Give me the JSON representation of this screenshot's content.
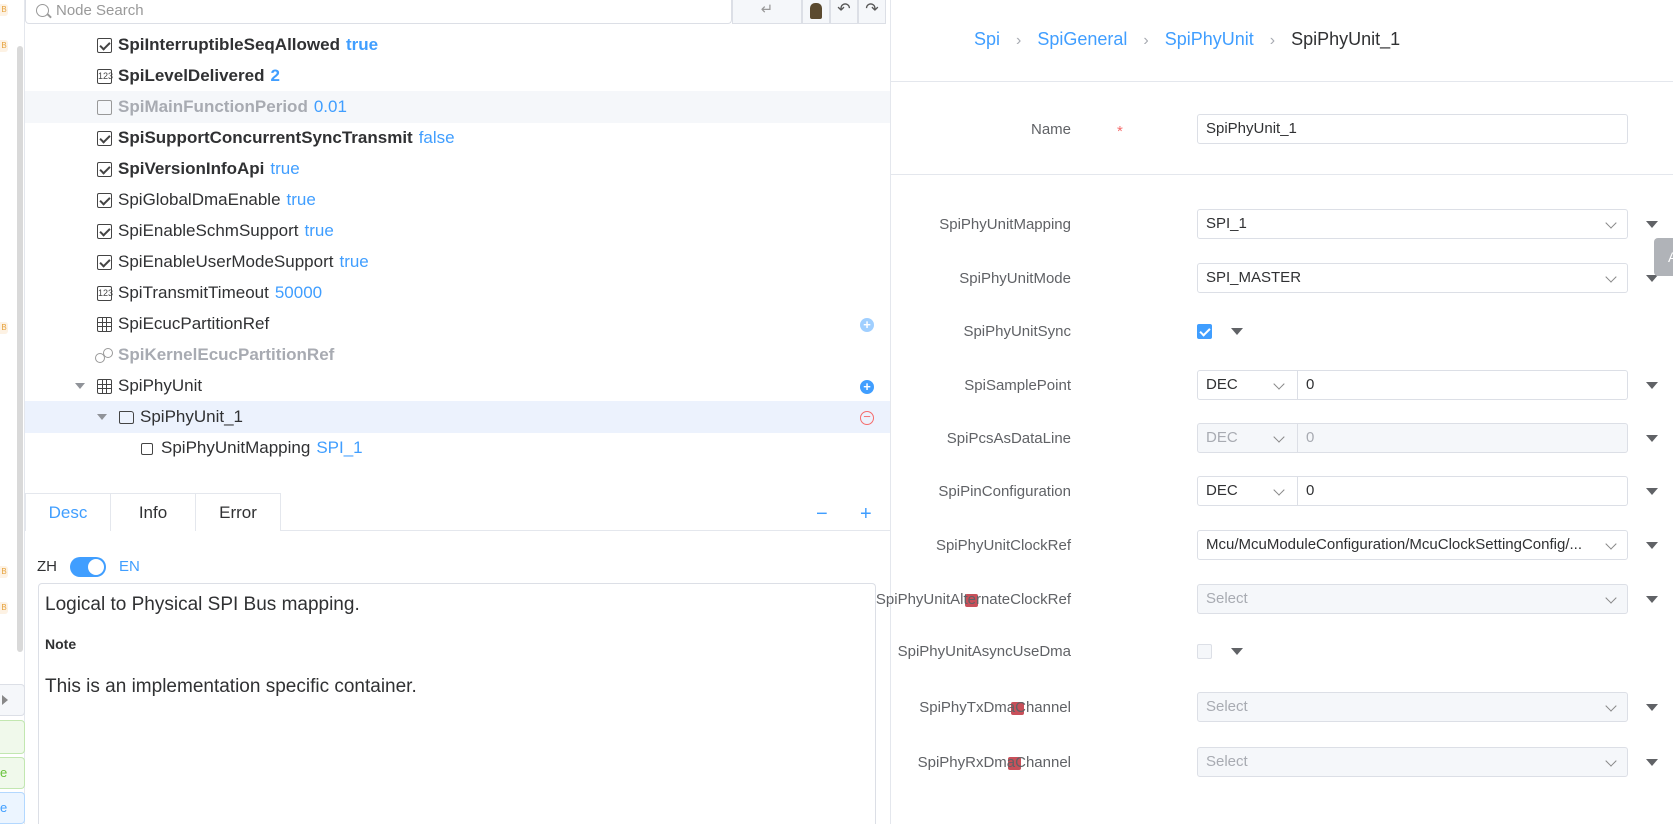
{
  "search": {
    "placeholder": "Node Search",
    "enter_glyph": "↵",
    "undo_glyph": "↶",
    "redo_glyph": "↷"
  },
  "strip": {
    "badge": "B",
    "btn_text_1": "e",
    "btn_text_2": "e"
  },
  "tree": {
    "rows": [
      {
        "label": "SpiInterruptibleSeqAllowed",
        "value": "true"
      },
      {
        "label": "SpiLevelDelivered",
        "value": "2"
      },
      {
        "label": "SpiMainFunctionPeriod",
        "value": "0.01"
      },
      {
        "label": "SpiSupportConcurrentSyncTransmit",
        "value": "false"
      },
      {
        "label": "SpiVersionInfoApi",
        "value": "true"
      },
      {
        "label": "SpiGlobalDmaEnable",
        "value": "true"
      },
      {
        "label": "SpiEnableSchmSupport",
        "value": "true"
      },
      {
        "label": "SpiEnableUserModeSupport",
        "value": "true"
      },
      {
        "label": "SpiTransmitTimeout",
        "value": "50000"
      },
      {
        "label": "SpiEcucPartitionRef",
        "value": ""
      },
      {
        "label": "SpiKernelEcucPartitionRef",
        "value": ""
      },
      {
        "label": "SpiPhyUnit",
        "value": ""
      },
      {
        "label": "SpiPhyUnit_1",
        "value": ""
      },
      {
        "label": "SpiPhyUnitMapping",
        "value": "SPI_1"
      }
    ],
    "num_icon": "123"
  },
  "tabs": {
    "desc": "Desc",
    "info": "Info",
    "error": "Error",
    "collapse": "−",
    "expand": "+"
  },
  "lang": {
    "zh": "ZH",
    "en": "EN"
  },
  "desc": {
    "line1": "Logical to Physical SPI Bus mapping.",
    "note": "Note",
    "line2": "This is an implementation specific container."
  },
  "breadcrumb": {
    "c1": "Spi",
    "c2": "SpiGeneral",
    "c3": "SpiPhyUnit",
    "current": "SpiPhyUnit_1",
    "sep": "›"
  },
  "form": {
    "name_label": "Name",
    "required_mark": "*",
    "name_value": "SpiPhyUnit_1",
    "mapping_label": "SpiPhyUnitMapping",
    "mapping_value": "SPI_1",
    "mode_label": "SpiPhyUnitMode",
    "mode_value": "SPI_MASTER",
    "sync_label": "SpiPhyUnitSync",
    "sample_label": "SpiSamplePoint",
    "sample_fmt": "DEC",
    "sample_value": "0",
    "pcs_label": "SpiPcsAsDataLine",
    "pcs_fmt": "DEC",
    "pcs_value": "0",
    "pin_label": "SpiPinConfiguration",
    "pin_fmt": "DEC",
    "pin_value": "0",
    "clock_label": "SpiPhyUnitClockRef",
    "clock_value": "Mcu/McuModuleConfiguration/McuClockSettingConfig/...",
    "altclock_label": "SpiPhyUnitAlternateClockRef",
    "altclock_value": "Select",
    "asyncdma_label": "SpiPhyUnitAsyncUseDma",
    "tx_label": "SpiPhyTxDmaChannel",
    "tx_value": "Select",
    "rx_label": "SpiPhyRxDmaChannel",
    "rx_value": "Select",
    "side_tab": "A"
  },
  "colors": {
    "accent": "#409eff",
    "required_box": "#c8505a",
    "danger": "#f56c6c"
  }
}
